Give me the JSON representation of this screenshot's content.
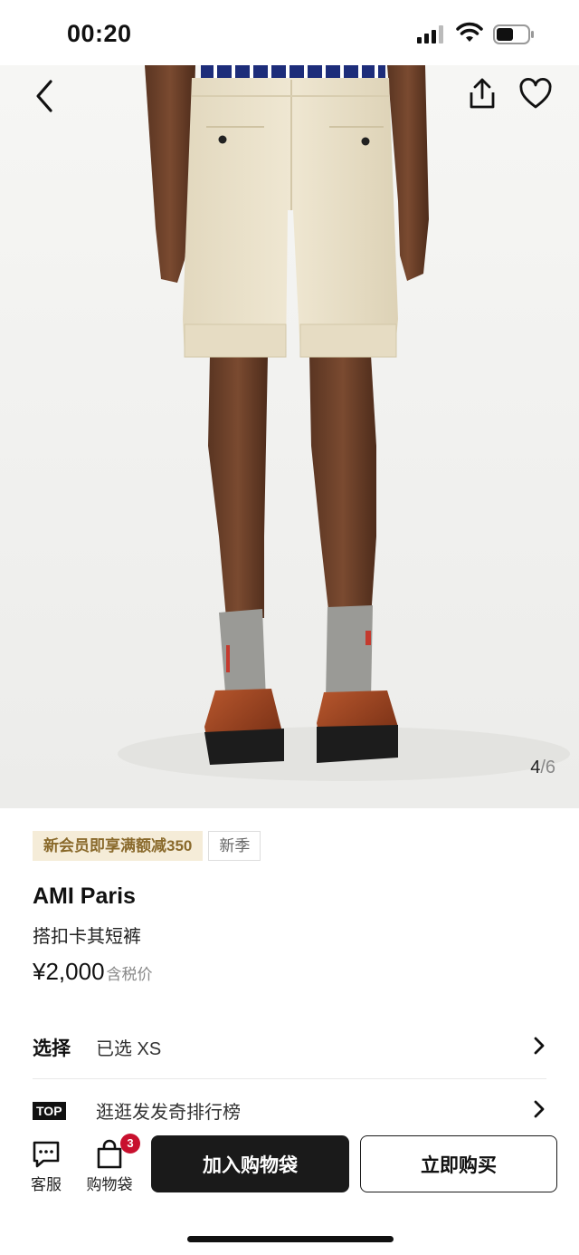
{
  "status_bar": {
    "time": "00:20"
  },
  "hero": {
    "page_current": "4",
    "page_sep": "/",
    "page_total": "6"
  },
  "tags": {
    "promo": "新会员即享满额减350",
    "season": "新季"
  },
  "product": {
    "brand": "AMI Paris",
    "name": "搭扣卡其短裤",
    "price": "¥2,000",
    "price_note": "含税价"
  },
  "select_row": {
    "label": "选择",
    "value": "已选 XS"
  },
  "top_row": {
    "badge": "TOP",
    "text": "逛逛发发奇排行榜"
  },
  "bottom_bar": {
    "service_label": "客服",
    "bag_label": "购物袋",
    "bag_count": "3",
    "add_to_bag": "加入购物袋",
    "buy_now": "立即购买"
  },
  "colors": {
    "badge_red": "#c8102e",
    "promo_bg": "#f5ecd8",
    "promo_text": "#8a6a2c",
    "primary_button": "#1a1a1a"
  },
  "icons": [
    "back-arrow-icon",
    "share-icon",
    "heart-icon",
    "chat-icon",
    "bag-icon",
    "chevron-right-icon",
    "signal-icon",
    "wifi-icon",
    "battery-icon"
  ]
}
